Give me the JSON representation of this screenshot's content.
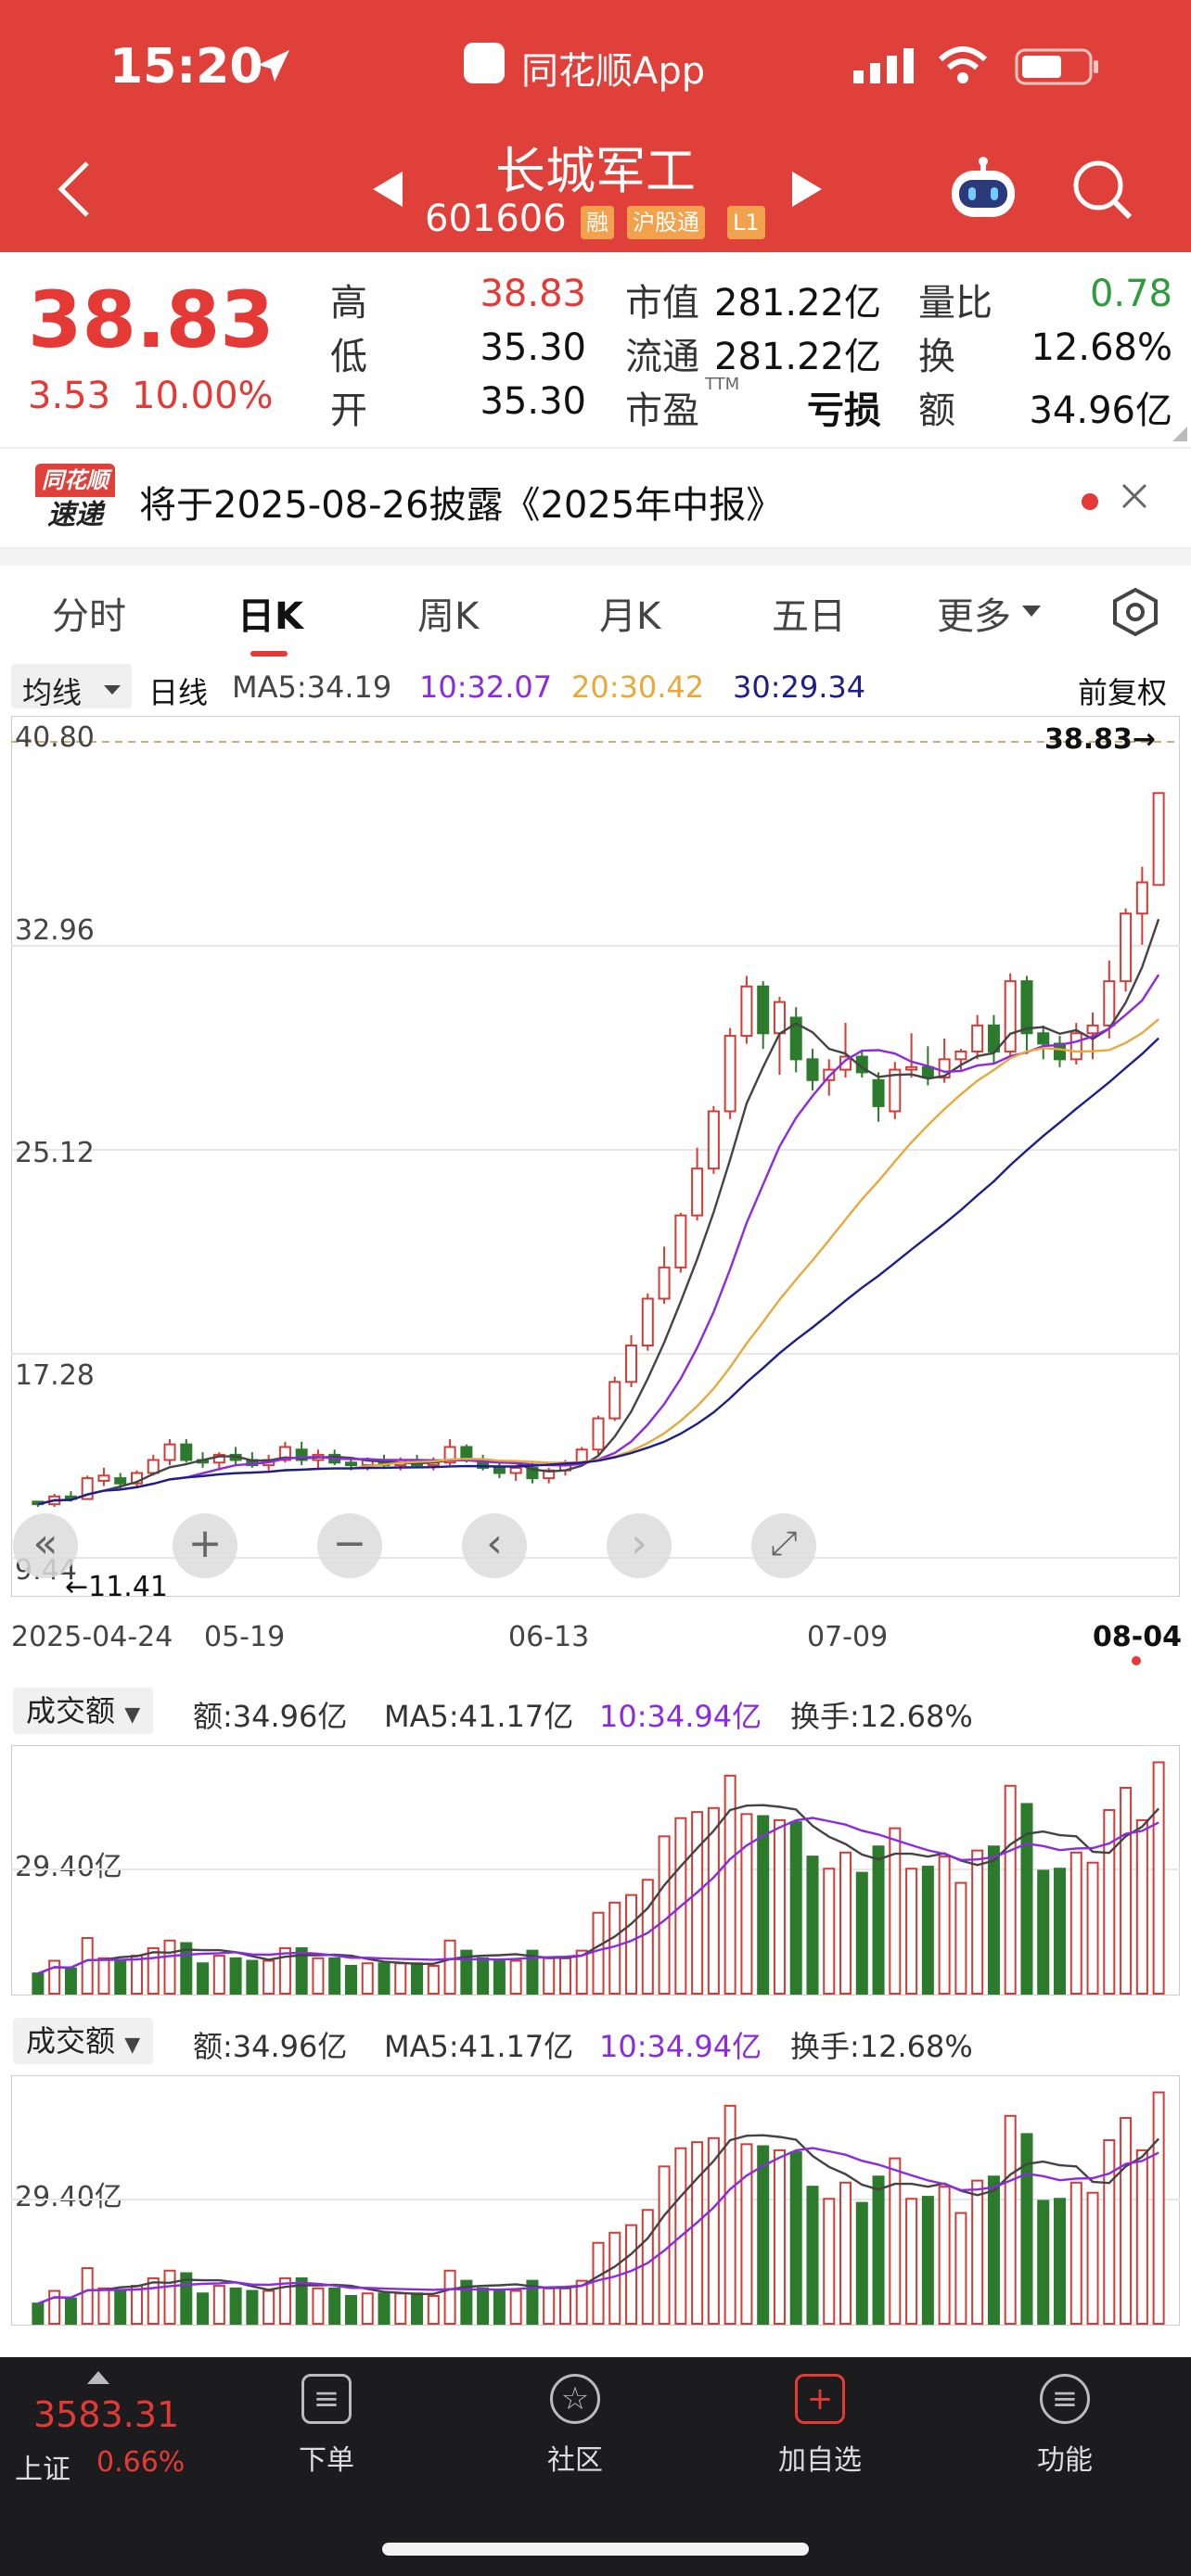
{
  "status": {
    "time": "15:20",
    "app_label": "同花顺App"
  },
  "nav": {
    "title": "长城军工",
    "code": "601606",
    "tags": [
      "融",
      "沪股通",
      "L1"
    ]
  },
  "quote": {
    "price": "38.83",
    "change": "3.53",
    "change_pct": "10.00%",
    "fields": [
      {
        "label": "高",
        "value": "38.83"
      },
      {
        "label": "低",
        "value": "35.30"
      },
      {
        "label": "开",
        "value": "35.30"
      },
      {
        "label": "市值",
        "value": "281.22亿"
      },
      {
        "label": "流通",
        "value": "281.22亿"
      },
      {
        "label": "市盈",
        "sup": "TTM",
        "value": "亏损"
      },
      {
        "label": "量比",
        "value": "0.78"
      },
      {
        "label": "换",
        "value": "12.68%"
      },
      {
        "label": "额",
        "value": "34.96亿"
      }
    ]
  },
  "notice": {
    "logo_top": "同花顺",
    "logo_bottom": "速递",
    "text": "将于2025-08-26披露《2025年中报》"
  },
  "tabs": [
    "分时",
    "日K",
    "周K",
    "月K",
    "五日",
    "更多"
  ],
  "active_tab": "日K",
  "ma_bar": {
    "selector": "均线",
    "period": "日线",
    "ma5": "MA5:34.19",
    "ma10": "10:32.07",
    "ma20": "20:30.42",
    "ma30": "30:29.34",
    "adjust": "前复权"
  },
  "colors": {
    "up": "#d23c36",
    "down": "#2c7a2c",
    "ma5": "#444444",
    "ma10": "#8a2be2",
    "ma20": "#e8a93a",
    "ma30": "#1d1d8c",
    "header": "#e0403a"
  },
  "chart_data": {
    "type": "candlestick",
    "y_ticks": [
      "40.80",
      "32.96",
      "25.12",
      "17.28",
      "9.44"
    ],
    "ylim": [
      9.44,
      40.8
    ],
    "high_marker": "38.83→",
    "low_marker": "←11.41",
    "dates": [
      "2025-04-24",
      "05-19",
      "06-13",
      "07-09",
      "08-04"
    ],
    "candles": [
      [
        11.6,
        11.6,
        11.4,
        11.5
      ],
      [
        11.5,
        11.9,
        11.4,
        11.8
      ],
      [
        11.8,
        12.0,
        11.6,
        11.7
      ],
      [
        11.7,
        12.6,
        11.7,
        12.5
      ],
      [
        12.4,
        12.9,
        12.2,
        12.6
      ],
      [
        12.5,
        12.7,
        12.1,
        12.3
      ],
      [
        12.3,
        12.8,
        12.2,
        12.7
      ],
      [
        12.7,
        13.4,
        12.6,
        13.2
      ],
      [
        13.2,
        14.0,
        13.0,
        13.8
      ],
      [
        13.8,
        14.0,
        13.1,
        13.2
      ],
      [
        13.2,
        13.5,
        12.9,
        13.1
      ],
      [
        13.1,
        13.5,
        12.8,
        13.4
      ],
      [
        13.4,
        13.7,
        13.0,
        13.2
      ],
      [
        13.2,
        13.5,
        12.9,
        13.0
      ],
      [
        13.0,
        13.4,
        12.8,
        13.2
      ],
      [
        13.2,
        13.9,
        13.1,
        13.7
      ],
      [
        13.6,
        13.9,
        13.0,
        13.2
      ],
      [
        13.2,
        13.6,
        12.9,
        13.4
      ],
      [
        13.4,
        13.6,
        13.0,
        13.1
      ],
      [
        13.1,
        13.3,
        12.8,
        13.0
      ],
      [
        13.0,
        13.3,
        12.8,
        13.2
      ],
      [
        13.2,
        13.4,
        12.9,
        13.0
      ],
      [
        13.0,
        13.3,
        12.8,
        13.2
      ],
      [
        13.2,
        13.4,
        12.9,
        13.0
      ],
      [
        13.0,
        13.3,
        12.8,
        13.1
      ],
      [
        13.1,
        14.0,
        13.0,
        13.7
      ],
      [
        13.7,
        13.8,
        13.1,
        13.2
      ],
      [
        13.2,
        13.4,
        12.8,
        12.9
      ],
      [
        12.9,
        13.1,
        12.5,
        12.7
      ],
      [
        12.7,
        13.0,
        12.4,
        12.9
      ],
      [
        12.9,
        13.1,
        12.3,
        12.5
      ],
      [
        12.5,
        12.9,
        12.3,
        12.8
      ],
      [
        12.8,
        13.2,
        12.6,
        13.1
      ],
      [
        13.1,
        13.7,
        13.0,
        13.6
      ],
      [
        13.6,
        14.9,
        13.4,
        14.8
      ],
      [
        14.8,
        16.4,
        14.7,
        16.2
      ],
      [
        16.2,
        18.0,
        16.0,
        17.6
      ],
      [
        17.6,
        19.6,
        17.4,
        19.4
      ],
      [
        19.4,
        21.4,
        19.2,
        20.6
      ],
      [
        20.6,
        22.7,
        20.4,
        22.6
      ],
      [
        22.6,
        25.2,
        22.4,
        24.4
      ],
      [
        24.4,
        26.8,
        24.2,
        26.6
      ],
      [
        26.6,
        29.8,
        26.3,
        29.5
      ],
      [
        29.5,
        31.8,
        29.2,
        31.4
      ],
      [
        31.4,
        31.6,
        29.0,
        29.6
      ],
      [
        29.6,
        31.0,
        28.0,
        30.8
      ],
      [
        30.2,
        30.6,
        28.1,
        28.6
      ],
      [
        28.6,
        29.0,
        27.4,
        27.8
      ],
      [
        27.8,
        28.6,
        27.2,
        28.2
      ],
      [
        28.2,
        30.0,
        27.9,
        28.7
      ],
      [
        28.7,
        28.9,
        27.9,
        28.1
      ],
      [
        27.8,
        28.1,
        26.2,
        26.8
      ],
      [
        26.6,
        28.5,
        26.3,
        28.2
      ],
      [
        28.2,
        29.6,
        27.9,
        28.3
      ],
      [
        28.3,
        29.1,
        27.6,
        27.9
      ],
      [
        27.9,
        29.4,
        27.7,
        28.6
      ],
      [
        28.6,
        29.0,
        28.2,
        28.9
      ],
      [
        28.9,
        30.3,
        28.6,
        29.9
      ],
      [
        29.9,
        30.3,
        28.4,
        28.9
      ],
      [
        28.9,
        31.9,
        28.7,
        31.6
      ],
      [
        31.6,
        31.8,
        28.8,
        29.6
      ],
      [
        29.6,
        29.9,
        28.6,
        29.2
      ],
      [
        29.2,
        29.5,
        28.3,
        28.6
      ],
      [
        28.6,
        30.0,
        28.4,
        29.6
      ],
      [
        29.6,
        30.4,
        28.6,
        29.9
      ],
      [
        29.9,
        32.4,
        29.4,
        31.6
      ],
      [
        31.6,
        34.4,
        31.2,
        34.2
      ],
      [
        34.2,
        36.0,
        33.0,
        35.4
      ],
      [
        35.3,
        38.83,
        35.3,
        38.83
      ]
    ],
    "volume": {
      "label": "成交额",
      "amount": "额:34.96亿",
      "ma5": "MA5:41.17亿",
      "ma10": "10:34.94亿",
      "turnover": "换手:12.68%",
      "tick": "29.40亿"
    }
  },
  "bottom_nav": {
    "index_value": "3583.31",
    "index_name": "上证",
    "index_change": "0.66%",
    "items": [
      "下单",
      "社区",
      "加自选",
      "功能"
    ]
  }
}
